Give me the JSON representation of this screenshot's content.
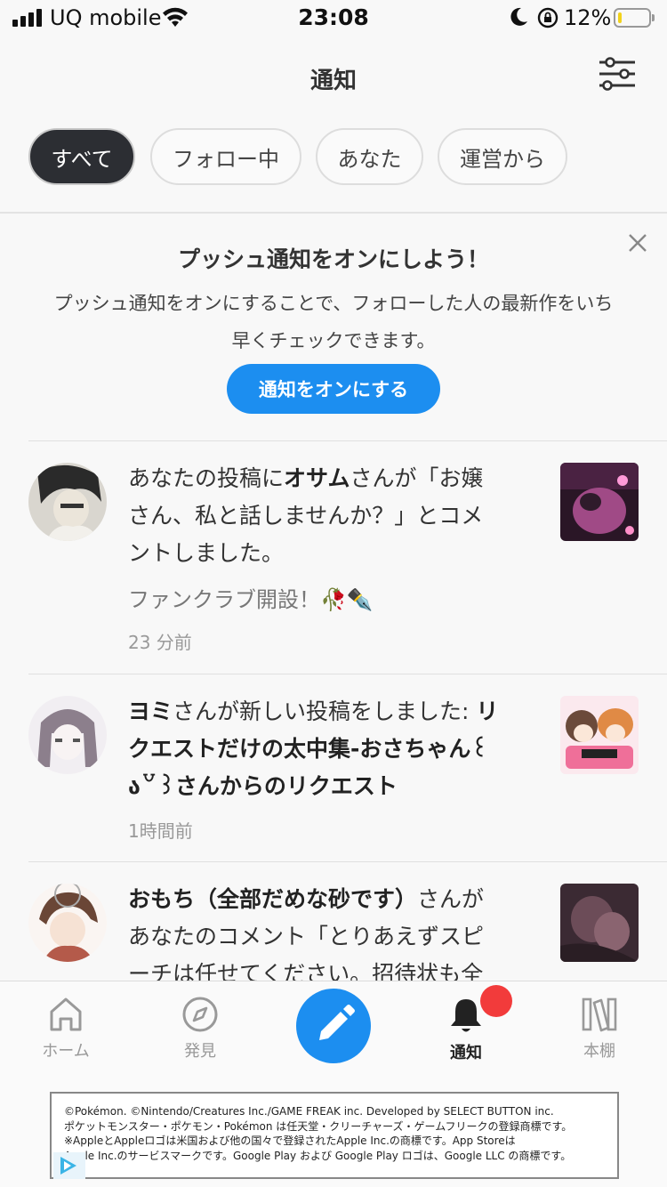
{
  "status_bar": {
    "carrier": "UQ mobile",
    "time": "23:08",
    "battery_percent": "12%",
    "battery_level": 0.12,
    "battery_color": "#f2d21b"
  },
  "header": {
    "title": "通知",
    "filter_icon": "sliders-icon"
  },
  "tabs": [
    {
      "label": "すべて",
      "active": true
    },
    {
      "label": "フォロー中",
      "active": false
    },
    {
      "label": "あなた",
      "active": false
    },
    {
      "label": "運営から",
      "active": false
    }
  ],
  "push_banner": {
    "title": "プッシュ通知をオンにしよう！",
    "description_line1": "プッシュ通知をオンにすることで、フォローした人の最新作をいち",
    "description_line2": "早くチェックできます。",
    "button_label": "通知をオンにする",
    "close_icon": "close-icon"
  },
  "notifications": [
    {
      "line1_prefix": "あなたの投稿に",
      "line1_name": "オサム",
      "line1_suffix": "さんが「お嬢",
      "line2": "さん、私と話しませんか？」とコメ",
      "line3": "ントしました。",
      "subtext": "ファンクラブ開設！🥀✒️",
      "time": "23 分前"
    },
    {
      "line1_name": "ヨミ",
      "line1_middle": "さんが新しい投稿をしました: ",
      "line1_title": "リ",
      "line2_title": "クエストだけの太中集-おさちゃん꒰",
      "line3_title": "ა꒵꒱",
      "line3_suffix": "さんからのリクエスト",
      "time": "1時間前"
    },
    {
      "line1_name": "おもち（全部だめな砂です）",
      "line1_suffix": "さんが",
      "line2": "あなたのコメント「とりあえずスピ",
      "line3": "ーチは任せてください。招待状も全"
    }
  ],
  "bottom_nav": [
    {
      "label": "ホーム",
      "icon": "home-icon",
      "active": false
    },
    {
      "label": "発見",
      "icon": "compass-icon",
      "active": false
    },
    {
      "label": "",
      "icon": "pencil-icon",
      "active": false
    },
    {
      "label": "通知",
      "icon": "bell-icon",
      "active": true
    },
    {
      "label": "本棚",
      "icon": "bookshelf-icon",
      "active": false
    }
  ],
  "colors": {
    "accent": "#1c8ef0",
    "active_tab": "#2c2e33",
    "badge": "#f23b3b"
  },
  "copyright": {
    "line1": "©Pokémon. ©Nintendo/Creatures Inc./GAME FREAK inc. Developed by SELECT BUTTON inc.",
    "line2": "ポケットモンスター・ポケモン・Pokémon は任天堂・クリーチャーズ・ゲームフリークの登録商標です。",
    "line3": "※AppleとAppleロゴは米国および他の国々で登録されたApple Inc.の商標です。App Storeは",
    "line4": "Apple Inc.のサービスマークです。Google Play および Google Play ロゴは、Google LLC の商標です。"
  }
}
